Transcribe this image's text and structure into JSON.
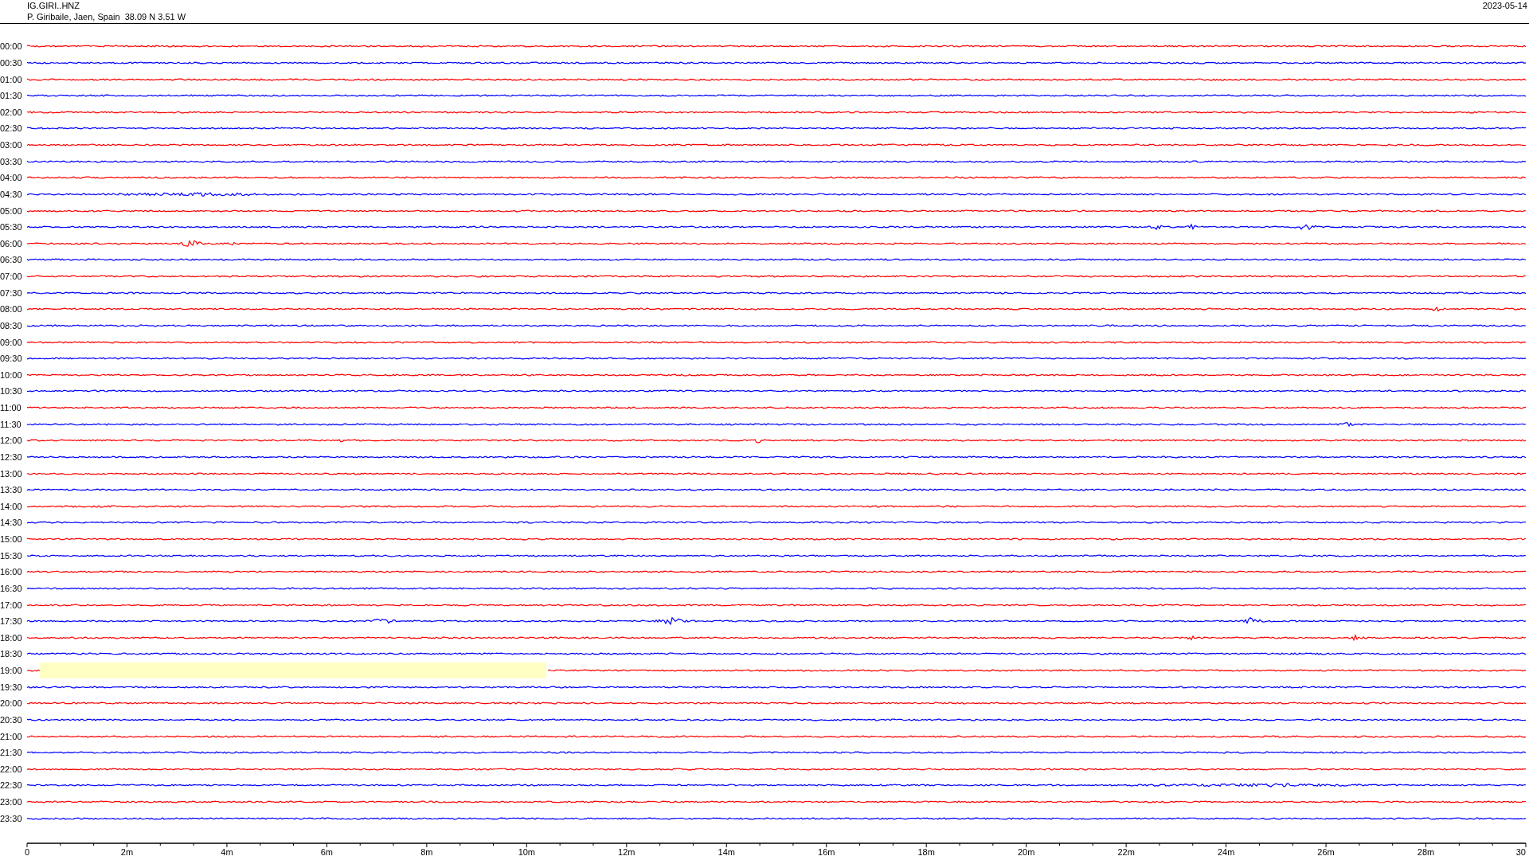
{
  "header": {
    "station": "IG.GIRI..HNZ",
    "location": "P. Giribaile, Jaen, Spain  38.09 N 3.51 W",
    "date": "2023-05-14"
  },
  "helicorder": {
    "rows": [
      {
        "label": "00:00",
        "color": "#ff0000",
        "gap": false
      },
      {
        "label": "00:30",
        "color": "#0000ff",
        "gap": false
      },
      {
        "label": "01:00",
        "color": "#ff0000",
        "gap": false
      },
      {
        "label": "01:30",
        "color": "#0000ff",
        "gap": false
      },
      {
        "label": "02:00",
        "color": "#ff0000",
        "gap": false
      },
      {
        "label": "02:30",
        "color": "#0000ff",
        "gap": false
      },
      {
        "label": "03:00",
        "color": "#ff0000",
        "gap": false
      },
      {
        "label": "03:30",
        "color": "#0000ff",
        "gap": false
      },
      {
        "label": "04:00",
        "color": "#ff0000",
        "gap": false
      },
      {
        "label": "04:30",
        "color": "#0000ff",
        "gap": false
      },
      {
        "label": "05:00",
        "color": "#ff0000",
        "gap": false
      },
      {
        "label": "05:30",
        "color": "#0000ff",
        "gap": false
      },
      {
        "label": "06:00",
        "color": "#ff0000",
        "gap": false
      },
      {
        "label": "06:30",
        "color": "#0000ff",
        "gap": false
      },
      {
        "label": "07:00",
        "color": "#ff0000",
        "gap": false
      },
      {
        "label": "07:30",
        "color": "#0000ff",
        "gap": false
      },
      {
        "label": "08:00",
        "color": "#ff0000",
        "gap": false
      },
      {
        "label": "08:30",
        "color": "#0000ff",
        "gap": false
      },
      {
        "label": "09:00",
        "color": "#ff0000",
        "gap": false
      },
      {
        "label": "09:30",
        "color": "#0000ff",
        "gap": false
      },
      {
        "label": "10:00",
        "color": "#ff0000",
        "gap": false
      },
      {
        "label": "10:30",
        "color": "#0000ff",
        "gap": false
      },
      {
        "label": "11:00",
        "color": "#ff0000",
        "gap": false
      },
      {
        "label": "11:30",
        "color": "#0000ff",
        "gap": false
      },
      {
        "label": "12:00",
        "color": "#ff0000",
        "gap": false
      },
      {
        "label": "12:30",
        "color": "#0000ff",
        "gap": false
      },
      {
        "label": "13:00",
        "color": "#ff0000",
        "gap": false
      },
      {
        "label": "13:30",
        "color": "#0000ff",
        "gap": false
      },
      {
        "label": "14:00",
        "color": "#ff0000",
        "gap": false
      },
      {
        "label": "14:30",
        "color": "#0000ff",
        "gap": false
      },
      {
        "label": "15:00",
        "color": "#ff0000",
        "gap": false
      },
      {
        "label": "15:30",
        "color": "#0000ff",
        "gap": false
      },
      {
        "label": "16:00",
        "color": "#ff0000",
        "gap": false
      },
      {
        "label": "16:30",
        "color": "#0000ff",
        "gap": false
      },
      {
        "label": "17:00",
        "color": "#ff0000",
        "gap": false
      },
      {
        "label": "17:30",
        "color": "#0000ff",
        "gap": false
      },
      {
        "label": "18:00",
        "color": "#ff0000",
        "gap": false
      },
      {
        "label": "18:30",
        "color": "#0000ff",
        "gap": false
      },
      {
        "label": "19:00",
        "color": "#ff0000",
        "gap": true
      },
      {
        "label": "19:30",
        "color": "#0000ff",
        "gap": false
      },
      {
        "label": "20:00",
        "color": "#ff0000",
        "gap": false
      },
      {
        "label": "20:30",
        "color": "#0000ff",
        "gap": false
      },
      {
        "label": "21:00",
        "color": "#ff0000",
        "gap": false
      },
      {
        "label": "21:30",
        "color": "#0000ff",
        "gap": false
      },
      {
        "label": "22:00",
        "color": "#ff0000",
        "gap": false
      },
      {
        "label": "22:30",
        "color": "#0000ff",
        "gap": false
      },
      {
        "label": "23:00",
        "color": "#ff0000",
        "gap": false
      },
      {
        "label": "23:30",
        "color": "#0000ff",
        "gap": false
      }
    ],
    "axis_labels": [
      "0",
      "2m",
      "4m",
      "6m",
      "8m",
      "10m",
      "12m",
      "14m",
      "16m",
      "18m",
      "20m",
      "22m",
      "24m",
      "26m",
      "28m",
      "30"
    ]
  }
}
